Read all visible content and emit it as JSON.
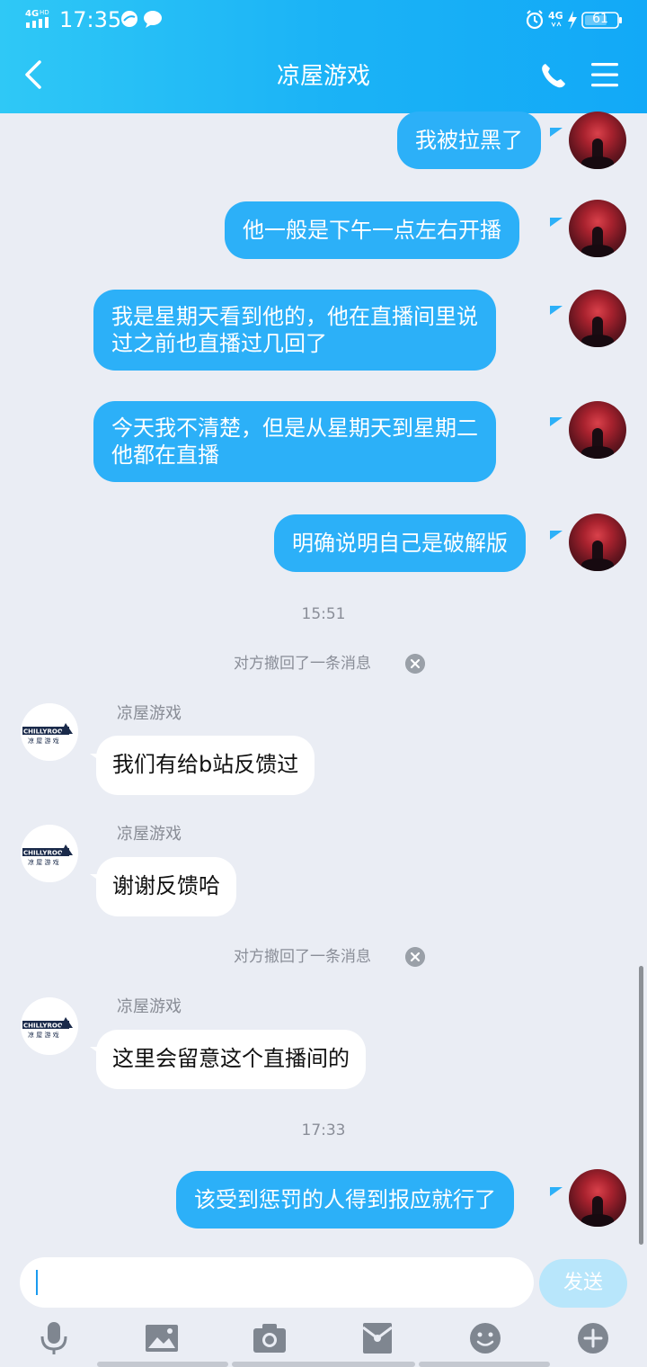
{
  "status_bar": {
    "network": "4G",
    "network_hd": "HD",
    "time": "17:35",
    "mobile_data": "4G",
    "battery": "61"
  },
  "header": {
    "title": "凉屋游戏"
  },
  "messages": [
    {
      "type": "out",
      "text": "我被拉黑了"
    },
    {
      "type": "out",
      "text": "他一般是下午一点左右开播"
    },
    {
      "type": "out",
      "lines": [
        "我是星期天看到他的，他在直播间里说",
        "过之前也直播过几回了"
      ]
    },
    {
      "type": "out",
      "lines": [
        "今天我不清楚，但是从星期天到星期二",
        "他都在直播"
      ]
    },
    {
      "type": "out",
      "text": "明确说明自己是破解版"
    },
    {
      "type": "time",
      "text": "15:51"
    },
    {
      "type": "recall",
      "text": "对方撤回了一条消息"
    },
    {
      "type": "in",
      "sender": "凉屋游戏",
      "text": "我们有给b站反馈过"
    },
    {
      "type": "in",
      "sender": "凉屋游戏",
      "text": "谢谢反馈哈"
    },
    {
      "type": "recall",
      "text": "对方撤回了一条消息"
    },
    {
      "type": "in",
      "sender": "凉屋游戏",
      "text": "这里会留意这个直播间的"
    },
    {
      "type": "time",
      "text": "17:33"
    },
    {
      "type": "out",
      "text": "该受到惩罚的人得到报应就行了"
    }
  ],
  "avatar_them": {
    "brand": "CHILLYROOM",
    "subtitle": "凉 屋 游 戏"
  },
  "input": {
    "value": "",
    "send_label": "发送"
  },
  "toolbar": [
    "voice-icon",
    "image-icon",
    "camera-icon",
    "red-packet-icon",
    "emoji-icon",
    "plus-icon"
  ],
  "colors": {
    "header": "#1bb3f6",
    "bubble_out": "#2cb0f8",
    "background": "#eaedf4",
    "send_disabled": "#b8e6fb"
  }
}
